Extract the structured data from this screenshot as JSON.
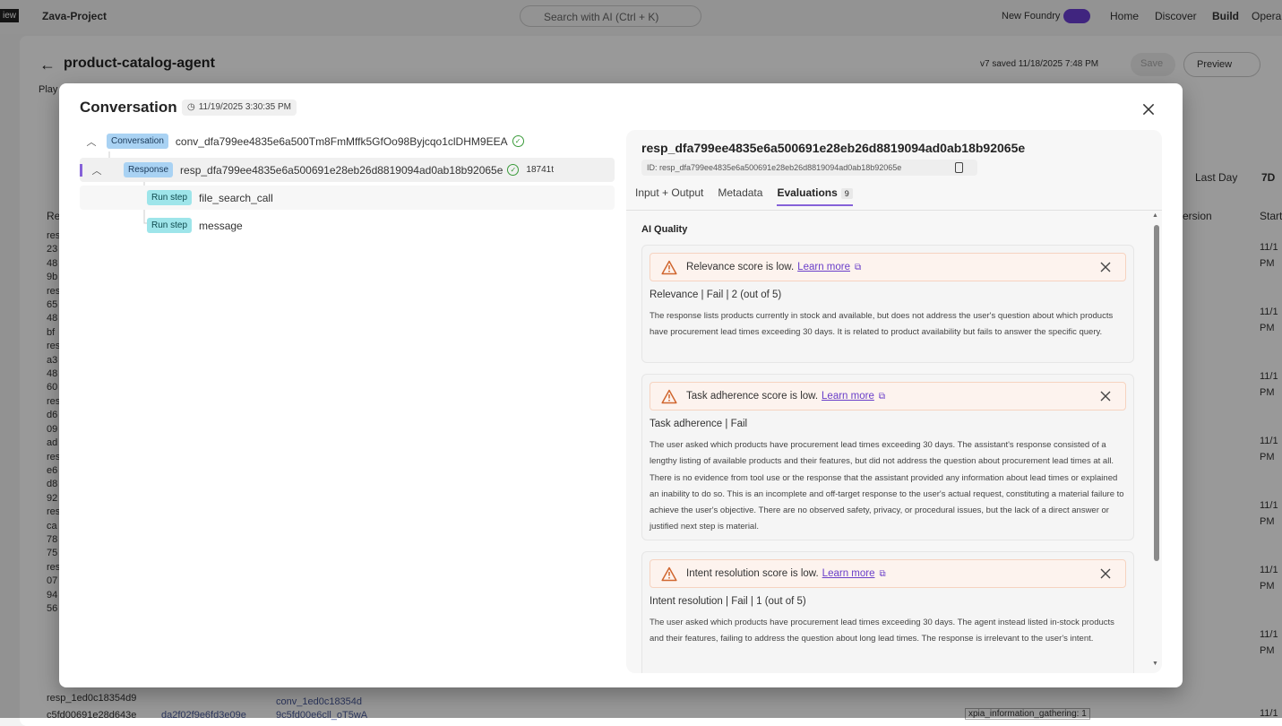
{
  "topbar": {
    "badge": "iew",
    "project": "Zava-Project",
    "search_placeholder": "Search with AI (Ctrl + K)",
    "new_foundry": "New Foundry",
    "nav": [
      "Home",
      "Discover",
      "Build",
      "Opera"
    ]
  },
  "page": {
    "title": "product-catalog-agent",
    "version": "v7 saved 11/18/2025 7:48 PM",
    "save": "Save",
    "preview": "Preview",
    "tab_partial": "Play",
    "time_filters": [
      "Last Day",
      "7D"
    ],
    "col_partial": [
      "Re",
      "ersion",
      "Start"
    ],
    "left_ids": [
      "res",
      "23",
      "48",
      "9b",
      "res",
      "65",
      "48",
      "bf",
      "res",
      "a3",
      "48",
      "60",
      "res",
      "d6",
      "09",
      "ad",
      "res",
      "e6",
      "d8",
      "92",
      "res",
      "ca",
      "78",
      "75",
      "res",
      "07",
      "94",
      "56"
    ],
    "right_dates": [
      "11/1",
      "PM"
    ],
    "bottom_row": {
      "resp": "resp_1ed0c18354d9",
      "resp2": "c5fd00691e28d643e",
      "agent": "da2f02f9e6fd3e09e",
      "conv": "conv_1ed0c18354d",
      "conv2": "9c5fd00e6cll_oT5wA",
      "tag": "xpia_information_gathering: 1",
      "date": "11/1"
    }
  },
  "modal": {
    "title": "Conversation",
    "timestamp": "11/19/2025 3:30:35 PM",
    "tree": [
      {
        "badge": "Conversation",
        "label": "conv_dfa799ee4835e6a500Tm8FmMffk5GfOo98Byjcqo1clDHM9EEA",
        "status": "success"
      },
      {
        "badge": "Response",
        "label": "resp_dfa799ee4835e6a500691e28eb26d8819094ad0ab18b92065e",
        "status": "success",
        "tokens": "18741t"
      },
      {
        "badge": "Run step",
        "label": "file_search_call"
      },
      {
        "badge": "Run step",
        "label": "message"
      }
    ],
    "detail": {
      "title": "resp_dfa799ee4835e6a500691e28eb26d8819094ad0ab18b92065e",
      "id": "ID: resp_dfa799ee4835e6a500691e28eb26d8819094ad0ab18b92065e",
      "tabs": [
        {
          "label": "Input + Output"
        },
        {
          "label": "Metadata"
        },
        {
          "label": "Evaluations",
          "count": "9",
          "active": true
        }
      ],
      "section": "AI Quality",
      "learn_more": "Learn more",
      "cards": [
        {
          "warning": "Relevance score is low.",
          "title": "Relevance | Fail | 2 (out of 5)",
          "body": "The response lists products currently in stock and available, but does not address the user's question about which products have procurement lead times exceeding 30 days. It is related to product availability but fails to answer the specific query."
        },
        {
          "warning": "Task adherence score is low.",
          "title": "Task adherence | Fail",
          "body": "The user asked which products have procurement lead times exceeding 30 days. The assistant's response consisted of a lengthy listing of available products and their features, but did not address the question about procurement lead times at all. There is no evidence from tool use or the response that the assistant provided any information about lead times or explained an inability to do so. This is an incomplete and off-target response to the user's actual request, constituting a material failure to achieve the user's objective. There are no observed safety, privacy, or procedural issues, but the lack of a direct answer or justified next step is material."
        },
        {
          "warning": "Intent resolution score is low.",
          "title": "Intent resolution | Fail | 1 (out of 5)",
          "body": "The user asked which products have procurement lead times exceeding 30 days. The agent instead listed in-stock products and their features, failing to address the question about long lead times. The response is irrelevant to the user's intent."
        }
      ]
    }
  },
  "colors": {
    "accent": "#8561d8",
    "warning": "#d0662f",
    "success": "#3a9b3a"
  }
}
